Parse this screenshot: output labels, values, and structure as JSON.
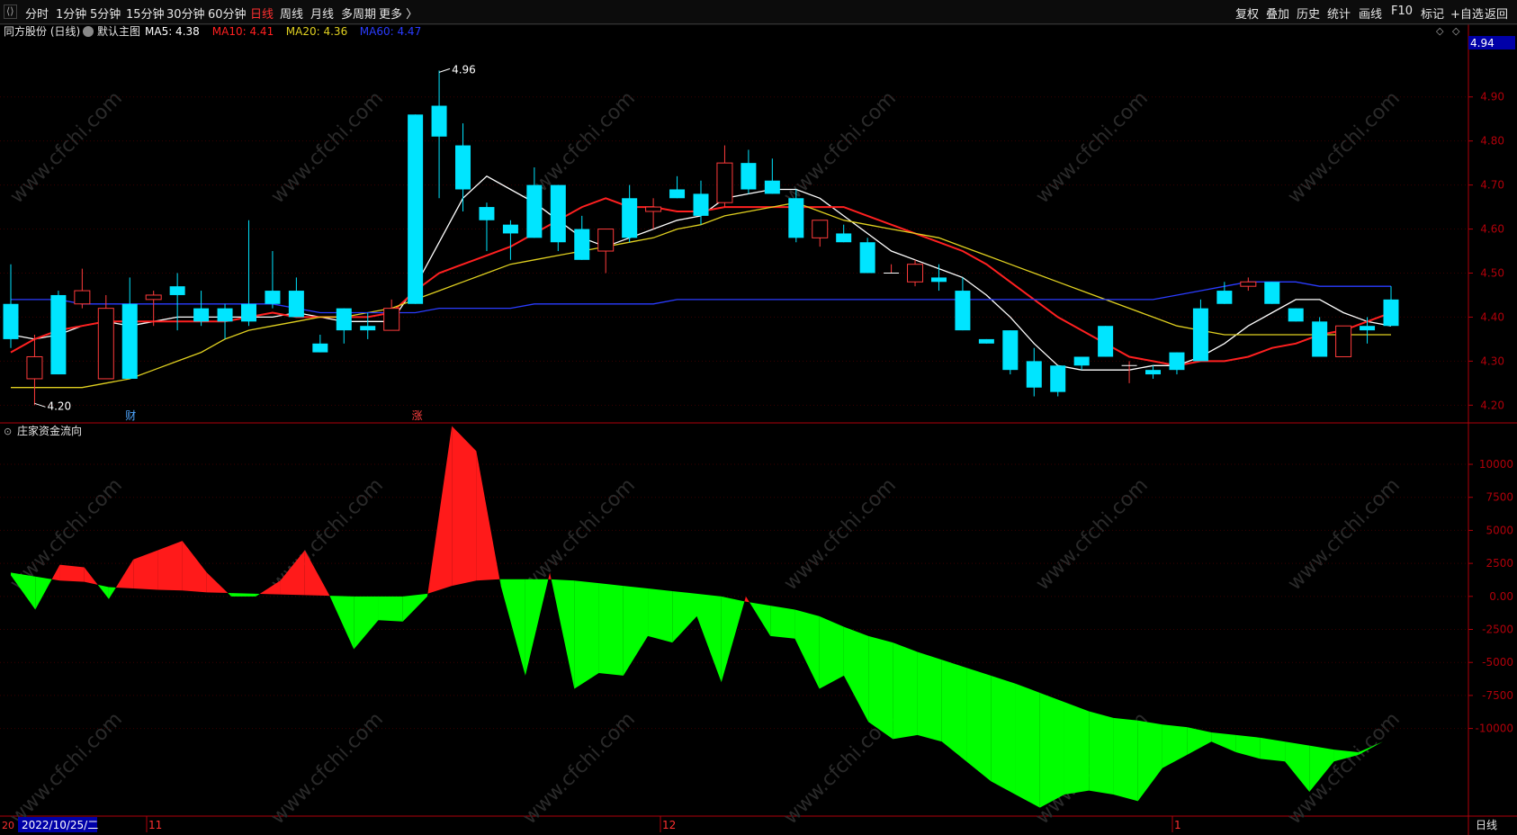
{
  "toolbar": {
    "collapse_icon": "collapse-icon",
    "periods": [
      "分时",
      "1分钟",
      "5分钟",
      "15分钟",
      "30分钟",
      "60分钟",
      "日线",
      "周线",
      "月线",
      "多周期",
      "更多 〉"
    ],
    "active_period": "日线",
    "right": [
      "复权",
      "叠加",
      "历史",
      "统计",
      "画线",
      "F10",
      "标记",
      "+自选",
      "返回"
    ]
  },
  "header": {
    "stock": "同方股份 (日线)",
    "view": "默认主图",
    "ma": [
      {
        "label": "MA5: 4.38",
        "color": "#ffffff"
      },
      {
        "label": "MA10: 4.41",
        "color": "#ff2020"
      },
      {
        "label": "MA20: 4.36",
        "color": "#e0d020"
      },
      {
        "label": "MA60: 4.47",
        "color": "#2a3cff"
      }
    ],
    "price_tag": "4.94"
  },
  "indicator_title": "庄家资金流向",
  "markers": {
    "finance": "财",
    "limit_up": "涨",
    "high": "4.96",
    "low": "4.20"
  },
  "bottom": {
    "date": "2022/10/25/二",
    "left_label": "20",
    "months": [
      "11",
      "12",
      "1"
    ],
    "period": "日线"
  },
  "watermark": "www.cfchi.com",
  "colors": {
    "up": "#ff3b3b",
    "down": "#00e5ff",
    "axis": "#b0000a",
    "flow_pos": "#ff1a1a",
    "flow_neg": "#00ff00"
  },
  "chart_data": [
    {
      "type": "candlestick",
      "ylim": [
        4.17,
        5.02
      ],
      "y_ticks": [
        4.2,
        4.3,
        4.4,
        4.5,
        4.6,
        4.7,
        4.8,
        4.9
      ],
      "candles": [
        [
          4.43,
          4.52,
          4.33,
          4.35
        ],
        [
          4.26,
          4.36,
          4.2,
          4.31
        ],
        [
          4.45,
          4.46,
          4.27,
          4.27
        ],
        [
          4.43,
          4.51,
          4.42,
          4.46
        ],
        [
          4.26,
          4.45,
          4.26,
          4.42
        ],
        [
          4.43,
          4.49,
          4.26,
          4.26
        ],
        [
          4.44,
          4.46,
          4.38,
          4.45
        ],
        [
          4.47,
          4.5,
          4.37,
          4.45
        ],
        [
          4.42,
          4.46,
          4.38,
          4.39
        ],
        [
          4.42,
          4.43,
          4.35,
          4.39
        ],
        [
          4.43,
          4.62,
          4.38,
          4.39
        ],
        [
          4.46,
          4.55,
          4.42,
          4.43
        ],
        [
          4.46,
          4.49,
          4.4,
          4.4
        ],
        [
          4.34,
          4.36,
          4.32,
          4.32
        ],
        [
          4.42,
          4.42,
          4.34,
          4.37
        ],
        [
          4.38,
          4.41,
          4.35,
          4.37
        ],
        [
          4.37,
          4.44,
          4.37,
          4.42
        ],
        [
          4.86,
          4.86,
          4.43,
          4.43
        ],
        [
          4.88,
          4.96,
          4.67,
          4.81
        ],
        [
          4.79,
          4.84,
          4.64,
          4.69
        ],
        [
          4.65,
          4.66,
          4.55,
          4.62
        ],
        [
          4.61,
          4.62,
          4.53,
          4.59
        ],
        [
          4.7,
          4.74,
          4.58,
          4.58
        ],
        [
          4.7,
          4.7,
          4.55,
          4.57
        ],
        [
          4.6,
          4.63,
          4.53,
          4.53
        ],
        [
          4.55,
          4.58,
          4.5,
          4.6
        ],
        [
          4.67,
          4.7,
          4.57,
          4.58
        ],
        [
          4.64,
          4.67,
          4.6,
          4.65
        ],
        [
          4.69,
          4.72,
          4.67,
          4.67
        ],
        [
          4.68,
          4.71,
          4.61,
          4.63
        ],
        [
          4.66,
          4.79,
          4.65,
          4.75
        ],
        [
          4.75,
          4.78,
          4.68,
          4.69
        ],
        [
          4.71,
          4.76,
          4.68,
          4.68
        ],
        [
          4.67,
          4.69,
          4.57,
          4.58
        ],
        [
          4.58,
          4.62,
          4.56,
          4.62
        ],
        [
          4.59,
          4.61,
          4.57,
          4.57
        ],
        [
          4.57,
          4.58,
          4.5,
          4.5
        ],
        [
          4.5,
          4.52,
          4.5,
          4.5
        ],
        [
          4.48,
          4.53,
          4.47,
          4.52
        ],
        [
          4.49,
          4.52,
          4.46,
          4.48
        ],
        [
          4.46,
          4.49,
          4.37,
          4.37
        ],
        [
          4.35,
          4.35,
          4.34,
          4.34
        ],
        [
          4.37,
          4.37,
          4.27,
          4.28
        ],
        [
          4.3,
          4.33,
          4.22,
          4.24
        ],
        [
          4.29,
          4.29,
          4.22,
          4.23
        ],
        [
          4.31,
          4.31,
          4.28,
          4.29
        ],
        [
          4.38,
          4.38,
          4.31,
          4.31
        ],
        [
          4.29,
          4.3,
          4.25,
          4.29
        ],
        [
          4.28,
          4.29,
          4.26,
          4.27
        ],
        [
          4.32,
          4.32,
          4.27,
          4.28
        ],
        [
          4.42,
          4.44,
          4.3,
          4.3
        ],
        [
          4.46,
          4.48,
          4.43,
          4.43
        ],
        [
          4.47,
          4.49,
          4.46,
          4.48
        ],
        [
          4.48,
          4.48,
          4.43,
          4.43
        ],
        [
          4.42,
          4.42,
          4.39,
          4.39
        ],
        [
          4.39,
          4.4,
          4.32,
          4.31
        ],
        [
          4.31,
          4.38,
          4.31,
          4.38
        ],
        [
          4.38,
          4.4,
          4.34,
          4.37
        ],
        [
          4.44,
          4.47,
          4.39,
          4.38
        ]
      ],
      "series": [
        {
          "name": "MA5",
          "color": "#ffffff",
          "values": [
            4.36,
            4.35,
            4.36,
            4.38,
            4.39,
            4.38,
            4.39,
            4.4,
            4.4,
            4.4,
            4.4,
            4.4,
            4.41,
            4.4,
            4.39,
            4.39,
            4.39,
            4.47,
            4.57,
            4.67,
            4.72,
            4.69,
            4.66,
            4.62,
            4.58,
            4.56,
            4.58,
            4.6,
            4.62,
            4.63,
            4.67,
            4.68,
            4.69,
            4.69,
            4.67,
            4.63,
            4.59,
            4.55,
            4.53,
            4.51,
            4.49,
            4.45,
            4.4,
            4.34,
            4.29,
            4.28,
            4.28,
            4.28,
            4.29,
            4.29,
            4.31,
            4.34,
            4.38,
            4.41,
            4.44,
            4.44,
            4.41,
            4.39,
            4.38
          ]
        },
        {
          "name": "MA10",
          "color": "#ff2020",
          "values": [
            4.32,
            4.35,
            4.37,
            4.38,
            4.39,
            4.39,
            4.39,
            4.39,
            4.39,
            4.39,
            4.4,
            4.41,
            4.4,
            4.4,
            4.4,
            4.4,
            4.41,
            4.46,
            4.5,
            4.52,
            4.54,
            4.56,
            4.59,
            4.62,
            4.65,
            4.67,
            4.65,
            4.65,
            4.64,
            4.64,
            4.65,
            4.65,
            4.65,
            4.65,
            4.65,
            4.65,
            4.63,
            4.61,
            4.59,
            4.57,
            4.55,
            4.52,
            4.48,
            4.44,
            4.4,
            4.37,
            4.34,
            4.31,
            4.3,
            4.29,
            4.3,
            4.3,
            4.31,
            4.33,
            4.34,
            4.36,
            4.37,
            4.39,
            4.41
          ]
        },
        {
          "name": "MA20",
          "color": "#e0d020",
          "values": [
            4.24,
            4.24,
            4.24,
            4.24,
            4.25,
            4.26,
            4.28,
            4.3,
            4.32,
            4.35,
            4.37,
            4.38,
            4.39,
            4.4,
            4.4,
            4.41,
            4.42,
            4.44,
            4.46,
            4.48,
            4.5,
            4.52,
            4.53,
            4.54,
            4.55,
            4.56,
            4.57,
            4.58,
            4.6,
            4.61,
            4.63,
            4.64,
            4.65,
            4.66,
            4.64,
            4.62,
            4.61,
            4.6,
            4.59,
            4.58,
            4.56,
            4.54,
            4.52,
            4.5,
            4.48,
            4.46,
            4.44,
            4.42,
            4.4,
            4.38,
            4.37,
            4.36,
            4.36,
            4.36,
            4.36,
            4.36,
            4.36,
            4.36,
            4.36
          ]
        },
        {
          "name": "MA60",
          "color": "#2a3cff",
          "values": [
            4.44,
            4.44,
            4.44,
            4.43,
            4.43,
            4.43,
            4.43,
            4.43,
            4.43,
            4.43,
            4.43,
            4.43,
            4.42,
            4.41,
            4.41,
            4.41,
            4.41,
            4.41,
            4.42,
            4.42,
            4.42,
            4.42,
            4.43,
            4.43,
            4.43,
            4.43,
            4.43,
            4.43,
            4.44,
            4.44,
            4.44,
            4.44,
            4.44,
            4.44,
            4.44,
            4.44,
            4.44,
            4.44,
            4.44,
            4.44,
            4.44,
            4.44,
            4.44,
            4.44,
            4.44,
            4.44,
            4.44,
            4.44,
            4.44,
            4.45,
            4.46,
            4.47,
            4.48,
            4.48,
            4.48,
            4.47,
            4.47,
            4.47,
            4.47
          ]
        }
      ]
    },
    {
      "type": "area",
      "title": "庄家资金流向",
      "ylim": [
        -16500,
        13000
      ],
      "y_ticks": [
        10000,
        7500,
        5000,
        2500,
        0.0,
        -2500,
        -5000,
        -7500,
        -10000
      ],
      "series": [
        {
          "name": "long",
          "values": [
            1600,
            -1000,
            2400,
            2200,
            -200,
            2800,
            3500,
            4200,
            1800,
            0,
            0,
            1200,
            3500,
            100,
            -4000,
            -1800,
            -1900,
            0,
            12900,
            11000,
            800,
            -6000,
            1800,
            -7000,
            -5800,
            -6000,
            -3000,
            -3500,
            -1500,
            -6500,
            0,
            -3000,
            -3200,
            -7000,
            -6000,
            -9500,
            -10800,
            -10500,
            -11000,
            -12500,
            -14000,
            -15000,
            -16000,
            -15000,
            -14700,
            -15000,
            -15500,
            -13000,
            -12000,
            -11000,
            -11800,
            -12300,
            -12500,
            -14800,
            -12500,
            -12000,
            -11000
          ]
        },
        {
          "name": "base",
          "values": [
            1800,
            1500,
            1200,
            1100,
            700,
            600,
            500,
            450,
            300,
            250,
            200,
            150,
            100,
            50,
            0,
            0,
            0,
            200,
            800,
            1200,
            1300,
            1300,
            1300,
            1200,
            1000,
            800,
            600,
            400,
            200,
            0,
            -400,
            -700,
            -1000,
            -1500,
            -2300,
            -3000,
            -3500,
            -4200,
            -4800,
            -5400,
            -6000,
            -6600,
            -7300,
            -8000,
            -8700,
            -9200,
            -9400,
            -9700,
            -9900,
            -10300,
            -10500,
            -10700,
            -11000,
            -11300,
            -11600,
            -11800,
            -11000
          ]
        }
      ]
    }
  ]
}
